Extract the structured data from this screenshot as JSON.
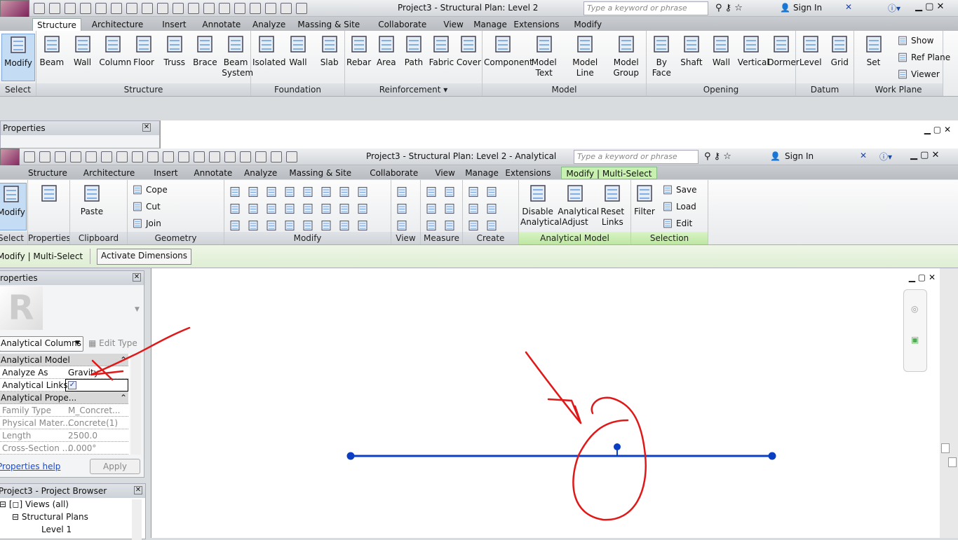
{
  "top": {
    "title": "Project3 - Structural Plan: Level 2",
    "search_placeholder": "Type a keyword or phrase",
    "sign_in": "Sign In",
    "tabs": [
      "Structure",
      "Architecture",
      "Insert",
      "Annotate",
      "Analyze",
      "Massing & Site",
      "Collaborate",
      "View",
      "Manage",
      "Extensions",
      "Modify"
    ],
    "panels": [
      {
        "label": "Select",
        "items": [
          "Modify"
        ]
      },
      {
        "label": "Structure",
        "items": [
          "Beam",
          "Wall",
          "Column",
          "Floor",
          "Truss",
          "Brace",
          "Beam System"
        ]
      },
      {
        "label": "Foundation",
        "items": [
          "Isolated",
          "Wall",
          "Slab"
        ]
      },
      {
        "label": "Reinforcement ▾",
        "items": [
          "Rebar",
          "Area",
          "Path",
          "Fabric",
          "Cover"
        ]
      },
      {
        "label": "Model",
        "items": [
          "Component",
          "Model Text",
          "Model Line",
          "Model Group"
        ]
      },
      {
        "label": "Opening",
        "items": [
          "By Face",
          "Shaft",
          "Wall",
          "Vertical",
          "Dormer"
        ]
      },
      {
        "label": "Datum",
        "items": [
          "Level",
          "Grid"
        ]
      },
      {
        "label": "Work Plane",
        "items": [
          "Set"
        ],
        "small": [
          "Show",
          "Ref Plane",
          "Viewer"
        ]
      }
    ],
    "properties_title": "Properties"
  },
  "second": {
    "title": "Project3 - Structural Plan: Level 2 - Analytical",
    "search_placeholder": "Type a keyword or phrase",
    "sign_in": "Sign In",
    "tabs": [
      "Structure",
      "Architecture",
      "Insert",
      "Annotate",
      "Analyze",
      "Massing & Site",
      "Collaborate",
      "View",
      "Manage",
      "Extensions",
      "Modify | Multi-Select"
    ],
    "panels": [
      {
        "label": "Select",
        "items": [
          "Modify"
        ]
      },
      {
        "label": "Properties",
        "items": [
          ""
        ]
      },
      {
        "label": "Clipboard",
        "items": [
          "Paste"
        ]
      },
      {
        "label": "Geometry",
        "small": [
          "Cope",
          "Cut",
          "Join"
        ]
      },
      {
        "label": "Modify",
        "items": []
      },
      {
        "label": "View",
        "items": []
      },
      {
        "label": "Measure",
        "items": []
      },
      {
        "label": "Create",
        "items": []
      },
      {
        "label": "Analytical Model",
        "items": [
          "Disable Analytical",
          "Analytical Adjust",
          "Reset Links"
        ]
      },
      {
        "label": "Selection",
        "items": [
          "Filter"
        ],
        "small": [
          "Save",
          "Load",
          "Edit"
        ]
      }
    ],
    "options_bar": {
      "context": "Modify | Multi-Select",
      "activate_dimensions": "Activate Dimensions"
    }
  },
  "properties": {
    "title": "Properties",
    "type_selector": "Analytical Columns",
    "edit_type": "Edit Type",
    "sections": [
      {
        "name": "Analytical Model",
        "rows": [
          [
            "Analyze As",
            "Gravity"
          ],
          [
            "Analytical Links",
            "checked"
          ]
        ]
      },
      {
        "name": "Analytical Prope...",
        "rows": [
          [
            "Family Type",
            "M_Concret..."
          ],
          [
            "Physical Mater...",
            "Concrete(1)"
          ],
          [
            "Length",
            "2500.0"
          ],
          [
            "Cross-Section ...",
            "0.000°"
          ]
        ]
      }
    ],
    "help": "Properties help",
    "apply": "Apply"
  },
  "browser": {
    "title": "Project3 - Project Browser",
    "items": [
      "Views (all)",
      "Structural Plans",
      "Level 1"
    ]
  },
  "colors": {
    "analytical_line": "#0a3fc4",
    "annotation": "#e01818",
    "active_tab": "#c8f0b0"
  }
}
